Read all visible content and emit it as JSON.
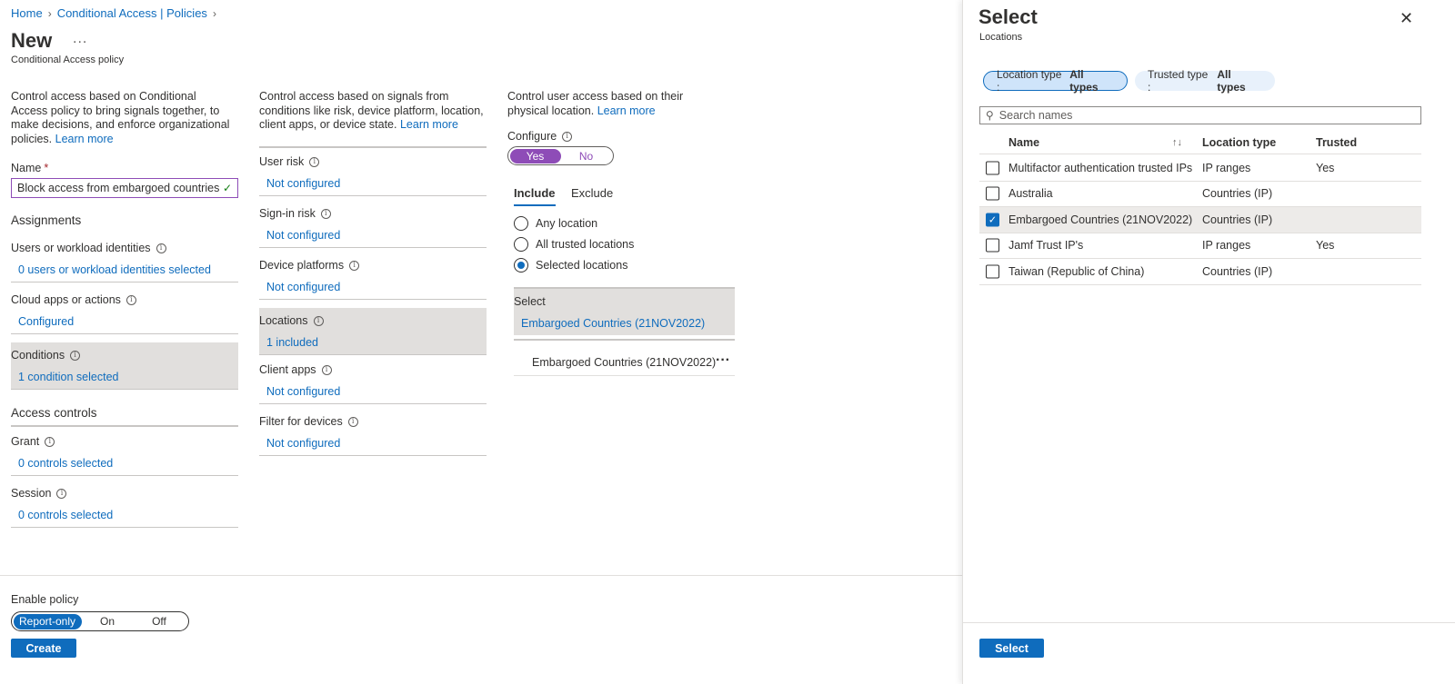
{
  "breadcrumb": {
    "home": "Home",
    "policies": "Conditional Access | Policies"
  },
  "header": {
    "title": "New",
    "more": "...",
    "subtitle": "Conditional Access policy"
  },
  "col1": {
    "desc": "Control access based on Conditional Access policy to bring signals together, to make decisions, and enforce organizational policies.",
    "learn_more": "Learn more",
    "name_label": "Name",
    "name_required": "*",
    "name_value": "Block access from embargoed countries",
    "assignments": "Assignments",
    "users_label": "Users or workload identities",
    "users_value": "0 users or workload identities selected",
    "cloud_label": "Cloud apps or actions",
    "cloud_value": "Configured",
    "conditions_label": "Conditions",
    "conditions_value": "1 condition selected",
    "access_controls": "Access controls",
    "grant_label": "Grant",
    "grant_value": "0 controls selected",
    "session_label": "Session",
    "session_value": "0 controls selected"
  },
  "col2": {
    "desc": "Control access based on signals from conditions like risk, device platform, location, client apps, or device state.",
    "learn_more": "Learn more",
    "items": [
      {
        "label": "User risk",
        "value": "Not configured"
      },
      {
        "label": "Sign-in risk",
        "value": "Not configured"
      },
      {
        "label": "Device platforms",
        "value": "Not configured"
      },
      {
        "label": "Locations",
        "value": "1 included"
      },
      {
        "label": "Client apps",
        "value": "Not configured"
      },
      {
        "label": "Filter for devices",
        "value": "Not configured"
      }
    ]
  },
  "col3": {
    "desc": "Control user access based on their physical location.",
    "learn_more": "Learn more",
    "configure_label": "Configure",
    "yes": "Yes",
    "no": "No",
    "tab_include": "Include",
    "tab_exclude": "Exclude",
    "radios": [
      "Any location",
      "All trusted locations",
      "Selected locations"
    ],
    "select_label": "Select",
    "select_value": "Embargoed Countries (21NOV2022)",
    "selected_item": "Embargoed Countries (21NOV2022)",
    "item_more": "···"
  },
  "footer": {
    "enable_policy": "Enable policy",
    "options": [
      "Report-only",
      "On",
      "Off"
    ],
    "create": "Create"
  },
  "panel": {
    "title": "Select",
    "subtitle": "Locations",
    "close": "✕",
    "chip1_key": "Location type :",
    "chip1_val": "All types",
    "chip2_key": "Trusted type :",
    "chip2_val": "All types",
    "search_placeholder": "Search names",
    "col_name": "Name",
    "col_type": "Location type",
    "col_trusted": "Trusted",
    "sort_icon": "↑↓",
    "rows": [
      {
        "name": "Multifactor authentication trusted IPs",
        "type": "IP ranges",
        "trusted": "Yes"
      },
      {
        "name": "Australia",
        "type": "Countries (IP)",
        "trusted": ""
      },
      {
        "name": "Embargoed Countries (21NOV2022)",
        "type": "Countries (IP)",
        "trusted": ""
      },
      {
        "name": "Jamf Trust IP's",
        "type": "IP ranges",
        "trusted": "Yes"
      },
      {
        "name": "Taiwan (Republic of China)",
        "type": "Countries (IP)",
        "trusted": ""
      }
    ],
    "select_button": "Select"
  },
  "colors": {
    "accent": "#0f6cbd",
    "toggle_purple": "#8e4cb7",
    "highlight": "#e1dfdd"
  }
}
